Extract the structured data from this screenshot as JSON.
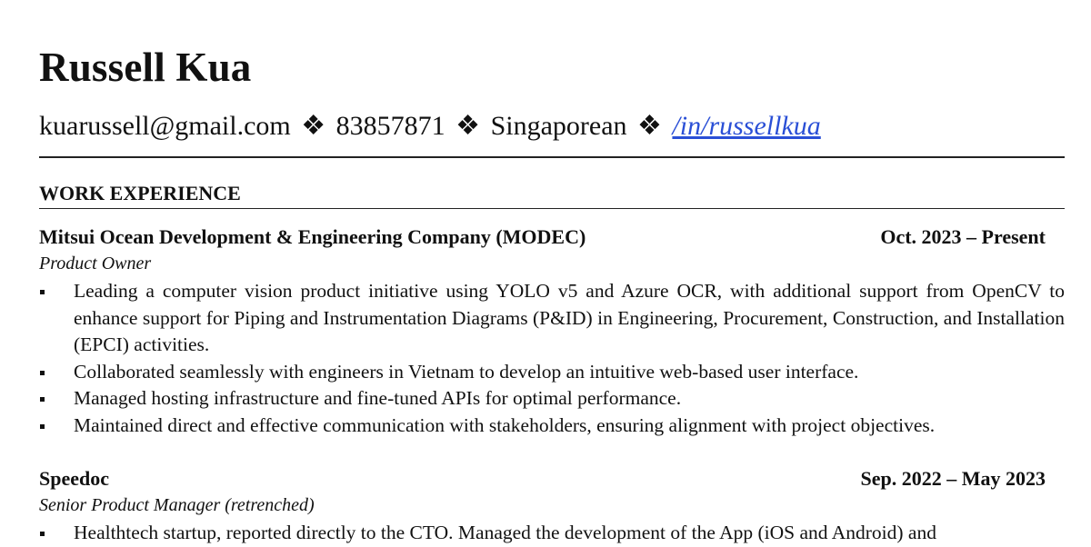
{
  "header": {
    "name": "Russell Kua",
    "email": "kuarussell@gmail.com",
    "separator": "❖",
    "phone": "83857871",
    "nationality": "Singaporean",
    "linkedin": "/in/russellkua",
    "link_color": "#2a4fd6"
  },
  "sections": {
    "work_experience": {
      "heading": "WORK EXPERIENCE",
      "jobs": [
        {
          "company": "Mitsui Ocean Development & Engineering Company (MODEC)",
          "dates": "Oct. 2023 – Present",
          "role": "Product Owner",
          "bullets": [
            "Leading a computer vision product initiative using YOLO v5 and Azure OCR, with additional support from OpenCV to enhance support for Piping and Instrumentation Diagrams (P&ID) in Engineering, Procurement, Construction, and Installation (EPCI) activities.",
            "Collaborated seamlessly with engineers in Vietnam to develop an intuitive web-based user interface.",
            "Managed hosting infrastructure and fine-tuned APIs for optimal performance.",
            "Maintained direct and effective communication with stakeholders, ensuring alignment with project objectives."
          ]
        },
        {
          "company": "Speedoc",
          "dates": "Sep. 2022 – May 2023",
          "role": "Senior Product Manager (retrenched)",
          "bullets": [
            "Healthtech startup, reported directly to the CTO. Managed the development of the App (iOS and Android) and"
          ]
        }
      ]
    }
  }
}
